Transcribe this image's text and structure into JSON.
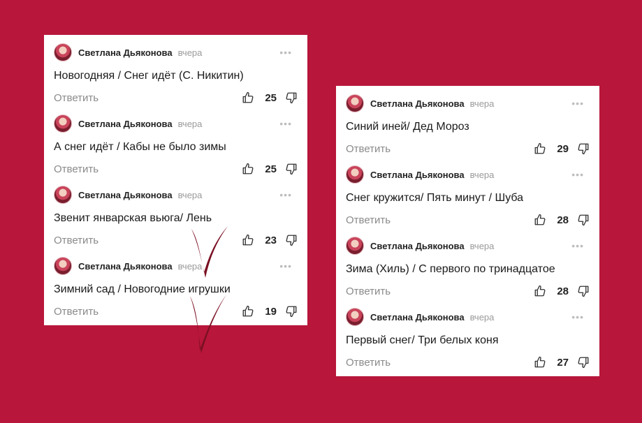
{
  "colors": {
    "background": "#b8163a",
    "panel": "#ffffff",
    "checkmark": "#7a1023"
  },
  "icons": {
    "avatar": "avatar",
    "more": "more-icon",
    "like": "thumbs-up-icon",
    "dislike": "thumbs-down-icon"
  },
  "more_glyph": "•••",
  "left_panel": {
    "comments": [
      {
        "author": "Светлана Дьяконова",
        "time": "вчера",
        "text": "Новогодняя / Снег идёт (С. Никитин)",
        "reply": "Ответить",
        "likes": "25"
      },
      {
        "author": "Светлана Дьяконова",
        "time": "вчера",
        "text": "А снег идёт / Кабы не было зимы",
        "reply": "Ответить",
        "likes": "25"
      },
      {
        "author": "Светлана Дьяконова",
        "time": "вчера",
        "text": "Звенит январская вьюга/ Лень",
        "reply": "Ответить",
        "likes": "23"
      },
      {
        "author": "Светлана Дьяконова",
        "time": "вчера",
        "text": "Зимний сад / Новогодние игрушки",
        "reply": "Ответить",
        "likes": "19"
      }
    ]
  },
  "right_panel": {
    "comments": [
      {
        "author": "Светлана Дьяконова",
        "time": "вчера",
        "text": "Синий иней/ Дед Мороз",
        "reply": "Ответить",
        "likes": "29"
      },
      {
        "author": "Светлана Дьяконова",
        "time": "вчера",
        "text": "Снег кружится/ Пять минут / Шуба",
        "reply": "Ответить",
        "likes": "28"
      },
      {
        "author": "Светлана Дьяконова",
        "time": "вчера",
        "text": "Зима (Хиль) / С первого по тринадцатое",
        "reply": "Ответить",
        "likes": "28"
      },
      {
        "author": "Светлана Дьяконова",
        "time": "вчера",
        "text": "Первый снег/ Три белых коня",
        "reply": "Ответить",
        "likes": "27"
      }
    ]
  }
}
